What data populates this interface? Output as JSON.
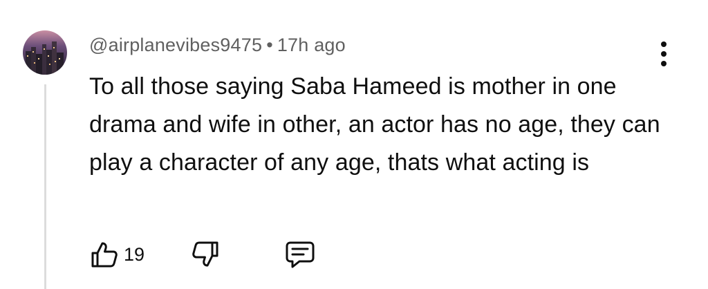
{
  "comment": {
    "author": "@airplanevibes9475",
    "separator": "•",
    "time": "17h ago",
    "text": "To all those saying Saba Hameed is mother in one drama and wife in other, an actor has no age, they can play a character of any age, thats what acting is"
  },
  "actions": {
    "like_count": "19"
  },
  "icons": {
    "avatar": "city-night-avatar",
    "more": "more-vert-icon",
    "like": "thumb-up-icon",
    "dislike": "thumb-down-icon",
    "reply": "reply-comment-icon"
  },
  "colors": {
    "text": "#0f0f0f",
    "meta": "#606060",
    "thread_line": "#dcdcdc"
  }
}
